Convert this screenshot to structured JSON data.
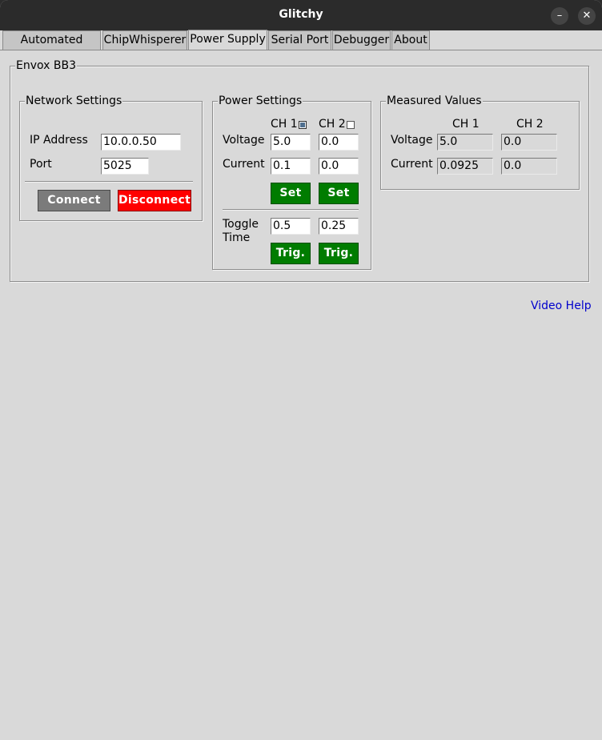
{
  "window": {
    "title": "Glitchy",
    "minimize_icon": "minimize-icon",
    "close_icon": "close-icon",
    "minimize_glyph": "–",
    "close_glyph": "✕"
  },
  "tabs": [
    {
      "label": "Automated Glitch",
      "active": false
    },
    {
      "label": "ChipWhisperer",
      "active": false
    },
    {
      "label": "Power Supply",
      "active": true
    },
    {
      "label": "Serial Port",
      "active": false
    },
    {
      "label": "Debugger",
      "active": false
    },
    {
      "label": "About",
      "active": false
    }
  ],
  "device_frame": {
    "title": "Envox BB3"
  },
  "network": {
    "title": "Network Settings",
    "ip_label": "IP Address",
    "ip_value": "10.0.0.50",
    "port_label": "Port",
    "port_value": "5025",
    "connect_label": "Connect",
    "disconnect_label": "Disconnect"
  },
  "power": {
    "title": "Power Settings",
    "ch1_label": "CH 1",
    "ch1_checked": true,
    "ch2_label": "CH 2",
    "ch2_checked": false,
    "voltage_label": "Voltage",
    "current_label": "Current",
    "ch1_voltage": "5.0",
    "ch2_voltage": "0.0",
    "ch1_current": "0.1",
    "ch2_current": "0.0",
    "set_label": "Set",
    "toggle_label_1": "Toggle",
    "toggle_label_2": "Time",
    "ch1_toggle": "0.5",
    "ch2_toggle": "0.25",
    "trig_label": "Trig."
  },
  "measured": {
    "title": "Measured Values",
    "ch1_label": "CH 1",
    "ch2_label": "CH 2",
    "voltage_label": "Voltage",
    "current_label": "Current",
    "ch1_voltage": "5.0",
    "ch2_voltage": "0.0",
    "ch1_current": "0.0925",
    "ch2_current": "0.0"
  },
  "help_link": "Video Help",
  "colors": {
    "accent_green": "#007c00",
    "danger_red": "#ff0000",
    "neutral_gray": "#7b7b7b",
    "link_blue": "#0000cc"
  }
}
